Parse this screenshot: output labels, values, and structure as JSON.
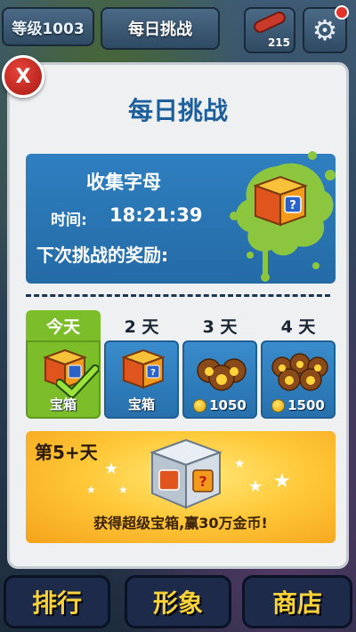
{
  "top_bar": {
    "level_label": "等级1003",
    "daily_challenge_label": "每日挑战",
    "board_count": "215",
    "board_icon": "hoverboard-icon",
    "settings_icon": "gear-icon"
  },
  "modal": {
    "close_label": "X",
    "title": "每日挑战",
    "challenge": {
      "name": "收集字母",
      "time_label": "时间:",
      "time_value": "18:21:39",
      "reward_label": "下次挑战的奖励:"
    },
    "days": [
      {
        "header": "今天",
        "reward_label": "宝箱",
        "reward_type": "mystery-box",
        "claimed": true
      },
      {
        "header": "2 天",
        "reward_label": "宝箱",
        "reward_type": "mystery-box",
        "claimed": false
      },
      {
        "header": "3 天",
        "reward_label": "1050",
        "reward_type": "coins",
        "claimed": false
      },
      {
        "header": "4 天",
        "reward_label": "1500",
        "reward_type": "coins",
        "claimed": false
      }
    ],
    "bonus": {
      "day_label": "第5+天",
      "description": "获得超级宝箱,赢30万金币!"
    }
  },
  "bottom_nav": {
    "leaderboard_label": "排行",
    "character_label": "形象",
    "shop_label": "商店"
  },
  "colors": {
    "title_blue": "#1c5f9a",
    "panel_blue": "#2f7fc0",
    "today_green": "#7cbd2a",
    "splat_green": "#8cc63f",
    "bonus_gold": "#ffc93a",
    "close_red": "#d8342a"
  }
}
